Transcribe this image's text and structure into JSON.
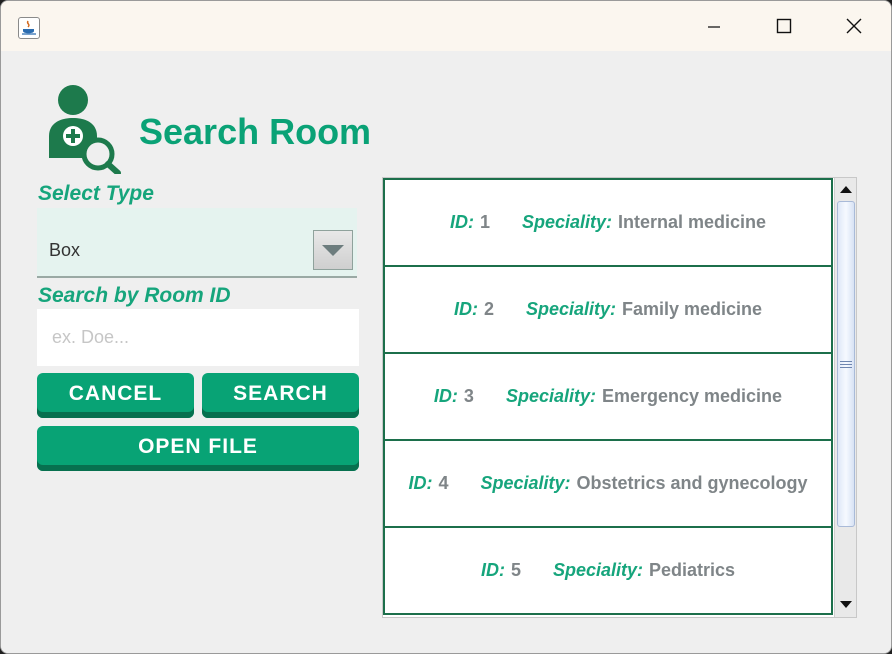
{
  "window": {
    "title": "",
    "controls": {
      "minimize": "minimize-icon",
      "maximize": "maximize-icon",
      "close": "close-icon"
    }
  },
  "header": {
    "title": "Search Room",
    "icon": "doctor-search-icon"
  },
  "filters": {
    "type_label": "Select Type",
    "type_value": "Box",
    "search_label": "Search by Room ID",
    "search_value": "",
    "search_placeholder": "ex. Doe..."
  },
  "buttons": {
    "cancel": "CANCEL",
    "search": "SEARCH",
    "open_file": "OPEN FILE"
  },
  "list": {
    "id_label": "ID:",
    "speciality_label": "Speciality:",
    "items": [
      {
        "id": "1",
        "speciality": "Internal medicine"
      },
      {
        "id": "2",
        "speciality": "Family medicine"
      },
      {
        "id": "3",
        "speciality": "Emergency medicine"
      },
      {
        "id": "4",
        "speciality": "Obstetrics and gynecology"
      },
      {
        "id": "5",
        "speciality": "Pediatrics"
      }
    ]
  },
  "colors": {
    "accent": "#0aa276",
    "button": "#08a375",
    "item_border": "#1c6f4b",
    "value_text": "#7f8588"
  }
}
